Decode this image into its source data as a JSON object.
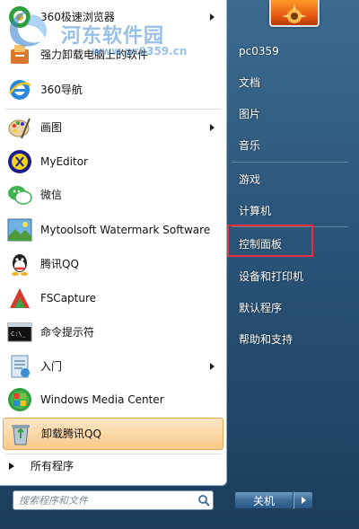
{
  "watermark": {
    "title": "河东软件园",
    "url": "www.pc0359.cn"
  },
  "programs": [
    {
      "label": "360极速浏览器",
      "icon": "360-browser-icon",
      "submenu": true
    },
    {
      "label": "强力卸载电脑上的软件",
      "icon": "uninstaller-icon",
      "submenu": false
    },
    {
      "label": "360导航",
      "icon": "ie-icon",
      "submenu": false
    },
    {
      "label": "画图",
      "icon": "paint-icon",
      "submenu": true
    },
    {
      "label": "MyEditor",
      "icon": "myeditor-icon",
      "submenu": false
    },
    {
      "label": "微信",
      "icon": "wechat-icon",
      "submenu": false
    },
    {
      "label": "Mytoolsoft Watermark Software",
      "icon": "watermark-software-icon",
      "submenu": false
    },
    {
      "label": "腾讯QQ",
      "icon": "qq-icon",
      "submenu": false
    },
    {
      "label": "FSCapture",
      "icon": "fscapture-icon",
      "submenu": false
    },
    {
      "label": "命令提示符",
      "icon": "cmd-icon",
      "submenu": false
    },
    {
      "label": "入门",
      "icon": "getting-started-icon",
      "submenu": true
    },
    {
      "label": "Windows Media Center",
      "icon": "media-center-icon",
      "submenu": false
    },
    {
      "label": "卸载腾讯QQ",
      "icon": "recycle-bin-icon",
      "submenu": false,
      "highlighted": true
    }
  ],
  "all_programs": "所有程序",
  "search": {
    "placeholder": "搜索程序和文件"
  },
  "right_items": [
    {
      "label": "pc0359",
      "name": "user-folder"
    },
    {
      "label": "文档",
      "name": "documents"
    },
    {
      "label": "图片",
      "name": "pictures"
    },
    {
      "label": "音乐",
      "name": "music"
    },
    {
      "label": "游戏",
      "name": "games"
    },
    {
      "label": "计算机",
      "name": "computer"
    },
    {
      "label": "控制面板",
      "name": "control-panel",
      "highlighted": true
    },
    {
      "label": "设备和打印机",
      "name": "devices-printers"
    },
    {
      "label": "默认程序",
      "name": "default-programs"
    },
    {
      "label": "帮助和支持",
      "name": "help-support"
    }
  ],
  "shutdown": {
    "label": "关机"
  },
  "colors": {
    "highlight_box": "#e8303a",
    "hover_bg": "#f9c98a",
    "accent": "#2a5478"
  }
}
